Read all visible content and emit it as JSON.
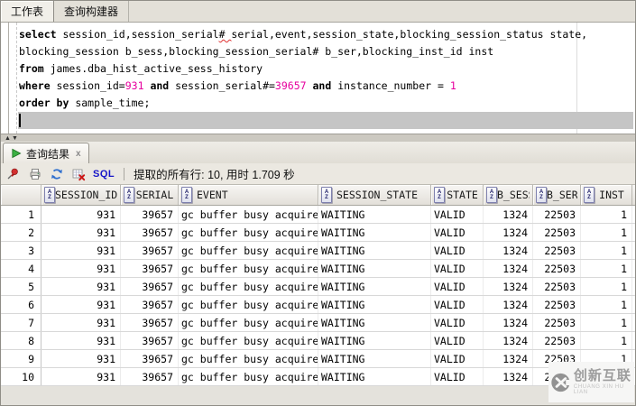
{
  "top_tabs": [
    {
      "label": "工作表"
    },
    {
      "label": "查询构建器"
    }
  ],
  "editor": {
    "lines": [
      [
        {
          "t": "select",
          "k": 1
        },
        {
          "t": " session_id,session_serial"
        },
        {
          "t": "# ",
          "w": 1
        },
        {
          "t": "serial,event,session_state,blocking_session_status state,"
        }
      ],
      [
        {
          "t": "blocking_session b_sess,blocking_session_serial# b_ser,blocking_inst_id inst"
        }
      ],
      [
        {
          "t": "from",
          "k": 1
        },
        {
          "t": " james.dba_hist_active_sess_history"
        }
      ],
      [
        {
          "t": "where",
          "k": 1
        },
        {
          "t": " session_id="
        },
        {
          "t": "931",
          "n": 1
        },
        {
          "t": " "
        },
        {
          "t": "and",
          "k": 1
        },
        {
          "t": " session_serial#="
        },
        {
          "t": "39657",
          "n": 1
        },
        {
          "t": " "
        },
        {
          "t": "and",
          "k": 1
        },
        {
          "t": " instance_number = "
        },
        {
          "t": "1",
          "n": 1
        }
      ],
      [
        {
          "t": "order by",
          "k": 1
        },
        {
          "t": " sample_time;"
        }
      ]
    ]
  },
  "results": {
    "tab_label": "查询结果",
    "close_label": "x",
    "toolbar": {
      "sql_label": "SQL",
      "status_text": "提取的所有行: 10, 用时 1.709 秒"
    },
    "table": {
      "columns": [
        {
          "key": "rownum",
          "label": "",
          "width": 45,
          "align": "right",
          "icon": false
        },
        {
          "key": "session_id",
          "label": "SESSION_ID",
          "width": 88,
          "align": "right",
          "icon": true
        },
        {
          "key": "serial",
          "label": "SERIAL",
          "width": 64,
          "align": "right",
          "icon": true
        },
        {
          "key": "event",
          "label": "EVENT",
          "width": 155,
          "align": "left",
          "icon": true,
          "halign": "left"
        },
        {
          "key": "session_state",
          "label": "SESSION_STATE",
          "width": 125,
          "align": "left",
          "icon": true,
          "halign": "left"
        },
        {
          "key": "state",
          "label": "STATE",
          "width": 58,
          "align": "left",
          "icon": true
        },
        {
          "key": "b_sess",
          "label": "B_SESS",
          "width": 55,
          "align": "right",
          "icon": true
        },
        {
          "key": "b_ser",
          "label": "B_SER",
          "width": 53,
          "align": "right",
          "icon": true
        },
        {
          "key": "inst",
          "label": "INST",
          "width": 57,
          "align": "right",
          "icon": true
        }
      ],
      "rows": [
        [
          "1",
          "931",
          "39657",
          "gc buffer busy acquire",
          "WAITING",
          "VALID",
          "1324",
          "22503",
          "1"
        ],
        [
          "2",
          "931",
          "39657",
          "gc buffer busy acquire",
          "WAITING",
          "VALID",
          "1324",
          "22503",
          "1"
        ],
        [
          "3",
          "931",
          "39657",
          "gc buffer busy acquire",
          "WAITING",
          "VALID",
          "1324",
          "22503",
          "1"
        ],
        [
          "4",
          "931",
          "39657",
          "gc buffer busy acquire",
          "WAITING",
          "VALID",
          "1324",
          "22503",
          "1"
        ],
        [
          "5",
          "931",
          "39657",
          "gc buffer busy acquire",
          "WAITING",
          "VALID",
          "1324",
          "22503",
          "1"
        ],
        [
          "6",
          "931",
          "39657",
          "gc buffer busy acquire",
          "WAITING",
          "VALID",
          "1324",
          "22503",
          "1"
        ],
        [
          "7",
          "931",
          "39657",
          "gc buffer busy acquire",
          "WAITING",
          "VALID",
          "1324",
          "22503",
          "1"
        ],
        [
          "8",
          "931",
          "39657",
          "gc buffer busy acquire",
          "WAITING",
          "VALID",
          "1324",
          "22503",
          "1"
        ],
        [
          "9",
          "931",
          "39657",
          "gc buffer busy acquire",
          "WAITING",
          "VALID",
          "1324",
          "22503",
          "1"
        ],
        [
          "10",
          "931",
          "39657",
          "gc buffer busy acquire",
          "WAITING",
          "VALID",
          "1324",
          "22503",
          "1"
        ]
      ]
    }
  },
  "watermark": {
    "title": "创新互联",
    "subtitle": "CHUANG XIN HU LIAN"
  },
  "colors": {
    "keyword": "#000000",
    "number_literal": "#e6009e",
    "sql_link": "#1515c8",
    "current_line": "#c5c5c5"
  }
}
